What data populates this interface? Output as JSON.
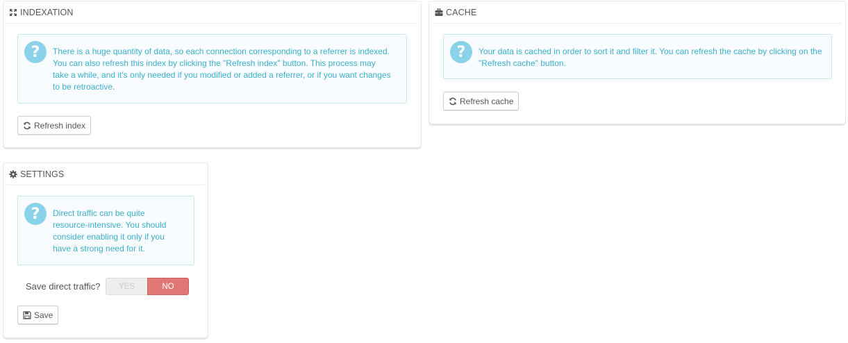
{
  "indexation": {
    "title": "INDEXATION",
    "icon": "expand-icon",
    "info_text": "There is a huge quantity of data, so each connection corresponding to a referrer is indexed. You can also refresh this index by clicking the \"Refresh index\" button. This process may take a while, and it's only needed if you modified or added a referrer, or if you want changes to be retroactive.",
    "button_label": "Refresh index"
  },
  "cache": {
    "title": "CACHE",
    "icon": "briefcase-icon",
    "info_text": "Your data is cached in order to sort it and filter it. You can refresh the cache by clicking on the \"Refresh cache\" button.",
    "button_label": "Refresh cache"
  },
  "settings": {
    "title": "SETTINGS",
    "icon": "gear-icon",
    "info_text": "Direct traffic can be quite resource-intensive. You should consider enabling it only if you have a strong need for it.",
    "switch_label": "Save direct traffic?",
    "switch_yes": "YES",
    "switch_no": "NO",
    "switch_value": "NO",
    "save_label": "Save"
  },
  "colors": {
    "info_text": "#3aafc9",
    "info_bg": "#f8fcfe",
    "info_icon": "#8ad1ea",
    "switch_no_active": "#e17875"
  }
}
